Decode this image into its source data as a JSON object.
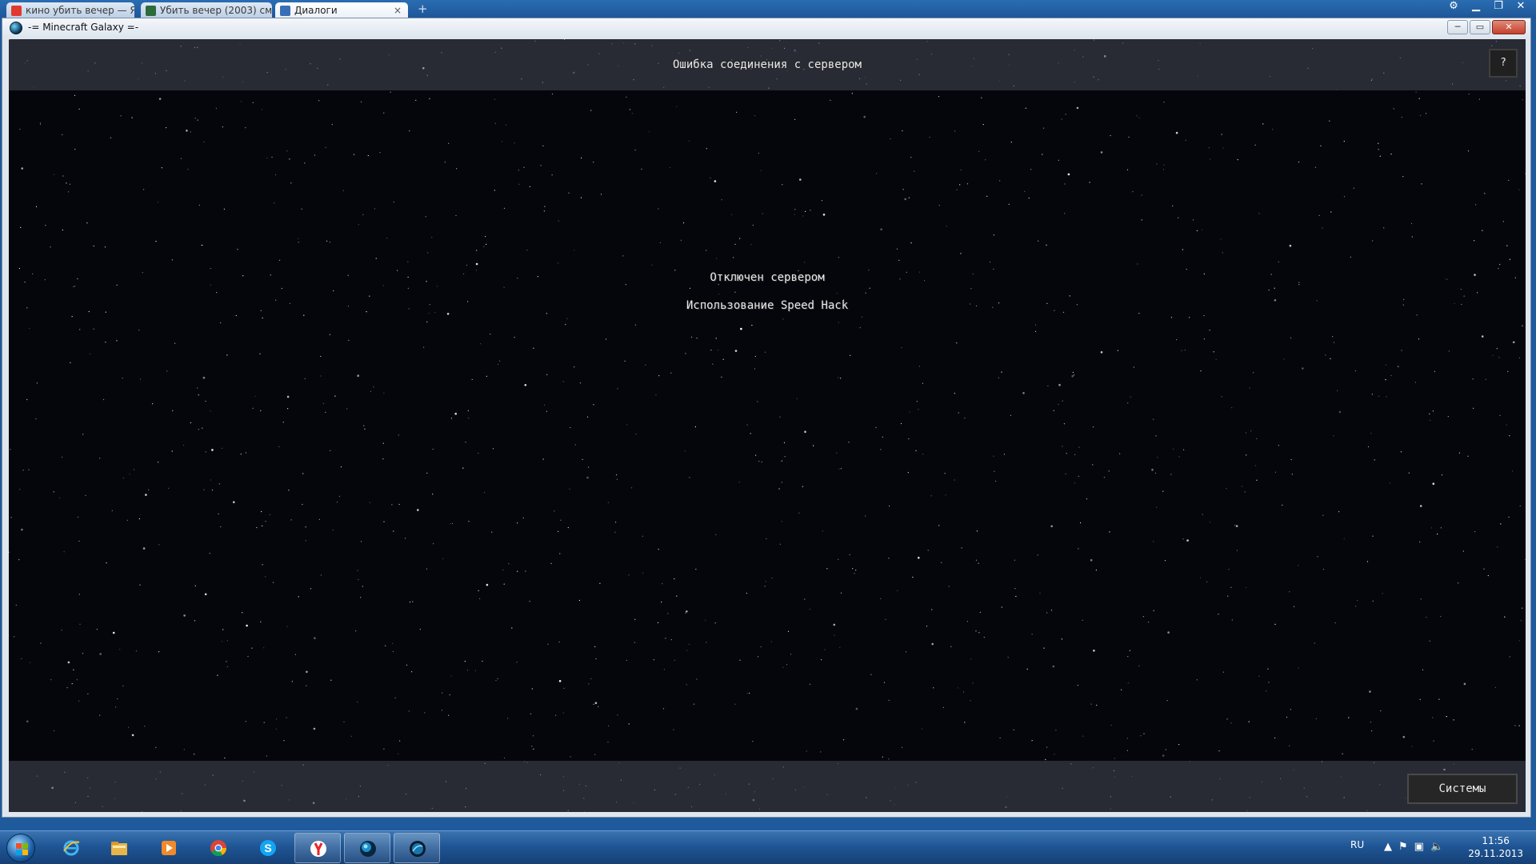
{
  "browser": {
    "tabs": [
      {
        "label": "кино убить вечер — Я",
        "icon_color": "#e03a2f",
        "active": false
      },
      {
        "label": "Убить вечер (2003) см",
        "icon_color": "#2d6b3c",
        "active": false
      },
      {
        "label": "Диалоги",
        "icon_color": "#3a6fb5",
        "active": true
      }
    ],
    "new_tab_label": "+",
    "controls": [
      "settings-gear",
      "minimize",
      "restore",
      "close"
    ]
  },
  "window": {
    "title": "-= Minecraft Galaxy =-",
    "buttons": {
      "minimize": "─",
      "maximize": "▭",
      "close": "✕"
    }
  },
  "game": {
    "screen_title": "Ошибка соединения с сервером",
    "help_label": "?",
    "messages": [
      "Отключен сервером",
      "Использование Speed Hack"
    ],
    "systems_button": "Системы"
  },
  "taskbar": {
    "pinned": [
      {
        "name": "internet-explorer-icon",
        "open": false
      },
      {
        "name": "file-explorer-icon",
        "open": false
      },
      {
        "name": "media-player-icon",
        "open": false
      },
      {
        "name": "chrome-icon",
        "open": false
      },
      {
        "name": "skype-icon",
        "open": false
      },
      {
        "name": "yandex-browser-icon",
        "open": true
      },
      {
        "name": "minecraft-galaxy-launcher-icon",
        "open": true
      },
      {
        "name": "minecraft-galaxy-game-icon",
        "open": true
      }
    ],
    "tray": {
      "language": "RU",
      "time": "11:56",
      "date": "29.11.2013"
    }
  }
}
